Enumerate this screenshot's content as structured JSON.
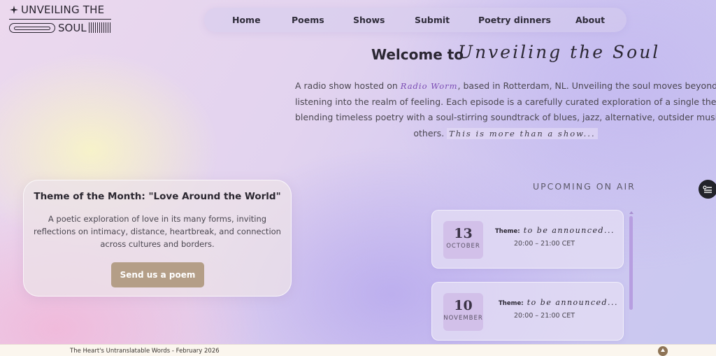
{
  "logo": {
    "line1": "UNVEILING THE",
    "line2": "SOUL"
  },
  "nav": {
    "items": [
      "Home",
      "Poems",
      "Shows",
      "Submit",
      "Poetry dinners",
      "About"
    ]
  },
  "hero": {
    "welcome": "Welcome to",
    "script_title": "Unveiling the Soul",
    "para_part1": "A radio show hosted on ",
    "radio_link": "Radio Worm",
    "para_part2": ", based in Rotterdam, NL. Unveiling the soul moves beyond mere",
    "line2": "listening into the realm of feeling. Each episode is a carefully curated exploration of a single theme,",
    "line3": "blending timeless poetry with a soul-stirring soundtrack of blues, jazz, alternative, outsider music and",
    "line4_part1": "others. ",
    "script_tag": "This is more than a show..."
  },
  "theme_card": {
    "title": "Theme of the Month: \"Love Around the World\"",
    "description": "A poetic exploration of love in its many forms, inviting reflections on intimacy, distance, heartbreak, and connection across cultures and borders.",
    "button": "Send us a poem"
  },
  "upcoming": {
    "title": "UPCOMING ON AIR",
    "shows": [
      {
        "day": "13",
        "month": "OCTOBER",
        "theme_label": "Theme:",
        "theme_value": "to be announced...",
        "time": "20:00 – 21:00 CET"
      },
      {
        "day": "10",
        "month": "NOVEMBER",
        "theme_label": "Theme:",
        "theme_value": "to be announced...",
        "time": "20:00 – 21:00 CET"
      }
    ]
  },
  "footer": {
    "text": "The Heart's Untranslatable Words - February 2026"
  },
  "icons": {
    "logo_star": "four-point-star",
    "side_button": "filter-settings-icon",
    "footer_button": "arrow-up-icon"
  },
  "colors": {
    "accent_button": "#b49e87",
    "date_box": "#d2c0e9",
    "link": "#7a4bb3",
    "scrollbar": "#b79ee0"
  }
}
